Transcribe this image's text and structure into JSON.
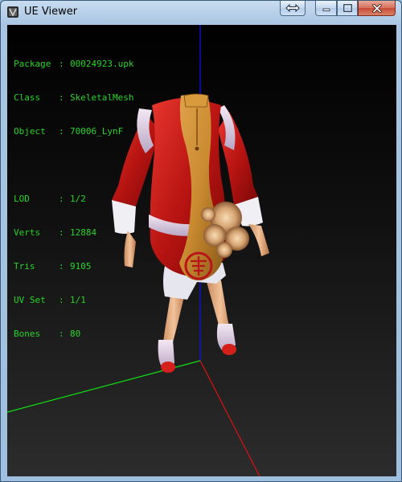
{
  "window": {
    "title": "UE Viewer",
    "icon": "ue-viewer-app-icon",
    "buttons": {
      "restore_arrows_icon": "left-right-arrow-icon",
      "minimize_icon": "minimize-icon",
      "maximize_icon": "maximize-icon",
      "close_icon": "close-icon"
    }
  },
  "info": {
    "package": {
      "label": "Package",
      "value": "00024923.upk"
    },
    "class": {
      "label": "Class",
      "value": "SkeletalMesh"
    },
    "object": {
      "label": "Object",
      "value": "70006_LynF"
    },
    "lod": {
      "label": "LOD",
      "value": "1/2"
    },
    "verts": {
      "label": "Verts",
      "value": "12884"
    },
    "tris": {
      "label": "Tris",
      "value": "9105"
    },
    "uvset": {
      "label": "UV Set",
      "value": "1/1"
    },
    "bones": {
      "label": "Bones",
      "value": "80"
    },
    "separator": ":",
    "text_color": "#26d626"
  },
  "viewport": {
    "axis_colors": {
      "x": "#e01010",
      "y": "#10e010",
      "z": "#1010ff"
    },
    "model": "red-and-gold-qipao-skeletal-mesh"
  }
}
